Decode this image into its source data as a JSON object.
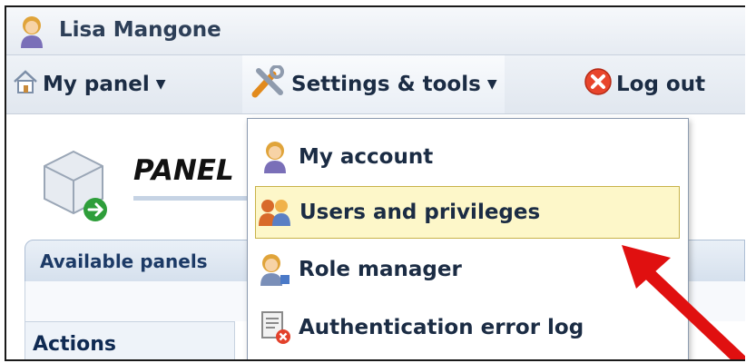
{
  "user": {
    "name": "Lisa Mangone"
  },
  "menu": {
    "items": [
      {
        "label": "My panel",
        "icon": "home-icon"
      },
      {
        "label": "Settings & tools",
        "icon": "tools-icon"
      },
      {
        "label": "Log out",
        "icon": "close-circle-icon"
      }
    ]
  },
  "dropdown": {
    "items": [
      {
        "label": "My account",
        "icon": "user-icon"
      },
      {
        "label": "Users and privileges",
        "icon": "users-icon",
        "highlighted": true
      },
      {
        "label": "Role manager",
        "icon": "role-user-icon"
      },
      {
        "label": "Authentication error log",
        "icon": "error-log-icon"
      }
    ]
  },
  "page": {
    "title": "PANEL",
    "tab_label": "Available panels",
    "actions_label": "Actions"
  },
  "colors": {
    "accent": "#1b2c44",
    "highlight_bg": "#fdf7c9",
    "arrow": "#e01010"
  }
}
